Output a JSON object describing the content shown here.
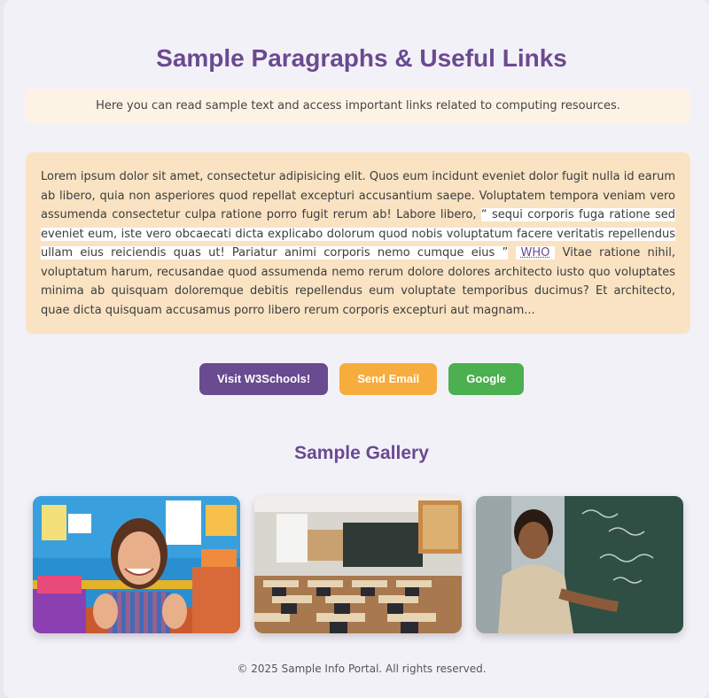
{
  "header": {
    "title": "Sample Paragraphs & Useful Links",
    "intro": "Here you can read sample text and access important links related to computing resources."
  },
  "paragraph": {
    "text_before": "Lorem ipsum dolor sit amet, consectetur adipisicing elit. Quos eum incidunt eveniet dolor fugit nulla id earum ab libero, quia non asperiores quod repellat excepturi accusantium saepe. Voluptatem tempora veniam vero assumenda consectetur culpa ratione porro fugit rerum ab! Labore libero, ",
    "quote": "“ sequi corporis fuga ratione sed eveniet eum, iste vero obcaecati dicta explicabo dolorum quod nobis voluptatum facere veritatis repellendus ullam eius reiciendis quas ut! Pariatur animi corporis nemo cumque eius ”",
    "abbr": "WHO",
    "text_after": " Vitae ratione nihil, voluptatum harum, recusandae quod assumenda nemo rerum dolore dolores architecto iusto quo voluptates minima ab quisquam doloremque debitis repellendus eum voluptate temporibus ducimus? Et architecto, quae dicta quisquam accusamus porro libero rerum corporis excepturi aut magnam..."
  },
  "buttons": [
    {
      "label": "Visit W3Schools!",
      "color": "#6a4a90"
    },
    {
      "label": "Send Email",
      "color": "#f7ac3e"
    },
    {
      "label": "Google",
      "color": "#4caf50"
    }
  ],
  "gallery": {
    "title": "Sample Gallery",
    "images": [
      {
        "alt": "smiling girl thumbs up"
      },
      {
        "alt": "empty classroom"
      },
      {
        "alt": "teacher at chalkboard"
      }
    ]
  },
  "footer": {
    "text": "© 2025 Sample Info Portal. All rights reserved."
  }
}
